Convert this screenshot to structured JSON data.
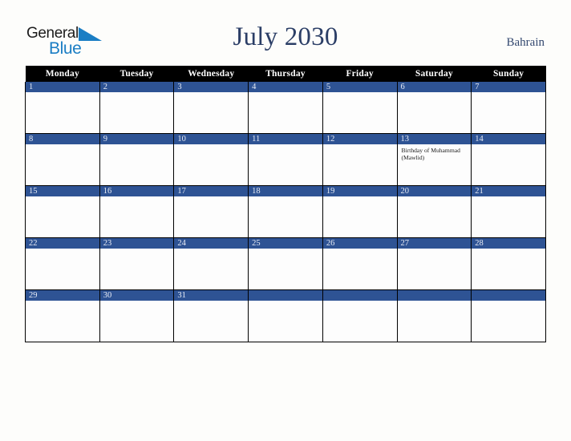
{
  "brand": {
    "word_general": "General",
    "word_blue": "Blue",
    "triangle_color": "#1b7ec4",
    "general_color": "#1c1c1c",
    "blue_color": "#1b7ec4"
  },
  "header": {
    "title": "July 2030",
    "country": "Bahrain",
    "title_color": "#2b3e66",
    "country_color": "#33486f"
  },
  "calendar": {
    "accent_blue": "#2e5394",
    "header_bg": "#000000",
    "header_fg": "#ffffff",
    "cell_bg": "#fdfdfd",
    "page_bg": "#fdfdfb",
    "weekday_headers": [
      "Monday",
      "Tuesday",
      "Wednesday",
      "Thursday",
      "Friday",
      "Saturday",
      "Sunday"
    ],
    "weeks": [
      [
        {
          "day": "1",
          "events": []
        },
        {
          "day": "2",
          "events": []
        },
        {
          "day": "3",
          "events": []
        },
        {
          "day": "4",
          "events": []
        },
        {
          "day": "5",
          "events": []
        },
        {
          "day": "6",
          "events": []
        },
        {
          "day": "7",
          "events": []
        }
      ],
      [
        {
          "day": "8",
          "events": []
        },
        {
          "day": "9",
          "events": []
        },
        {
          "day": "10",
          "events": []
        },
        {
          "day": "11",
          "events": []
        },
        {
          "day": "12",
          "events": []
        },
        {
          "day": "13",
          "events": [
            "Birthday of Muhammad (Mawlid)"
          ]
        },
        {
          "day": "14",
          "events": []
        }
      ],
      [
        {
          "day": "15",
          "events": []
        },
        {
          "day": "16",
          "events": []
        },
        {
          "day": "17",
          "events": []
        },
        {
          "day": "18",
          "events": []
        },
        {
          "day": "19",
          "events": []
        },
        {
          "day": "20",
          "events": []
        },
        {
          "day": "21",
          "events": []
        }
      ],
      [
        {
          "day": "22",
          "events": []
        },
        {
          "day": "23",
          "events": []
        },
        {
          "day": "24",
          "events": []
        },
        {
          "day": "25",
          "events": []
        },
        {
          "day": "26",
          "events": []
        },
        {
          "day": "27",
          "events": []
        },
        {
          "day": "28",
          "events": []
        }
      ],
      [
        {
          "day": "29",
          "events": []
        },
        {
          "day": "30",
          "events": []
        },
        {
          "day": "31",
          "events": []
        },
        {
          "day": "",
          "events": []
        },
        {
          "day": "",
          "events": []
        },
        {
          "day": "",
          "events": []
        },
        {
          "day": "",
          "events": []
        }
      ]
    ]
  }
}
